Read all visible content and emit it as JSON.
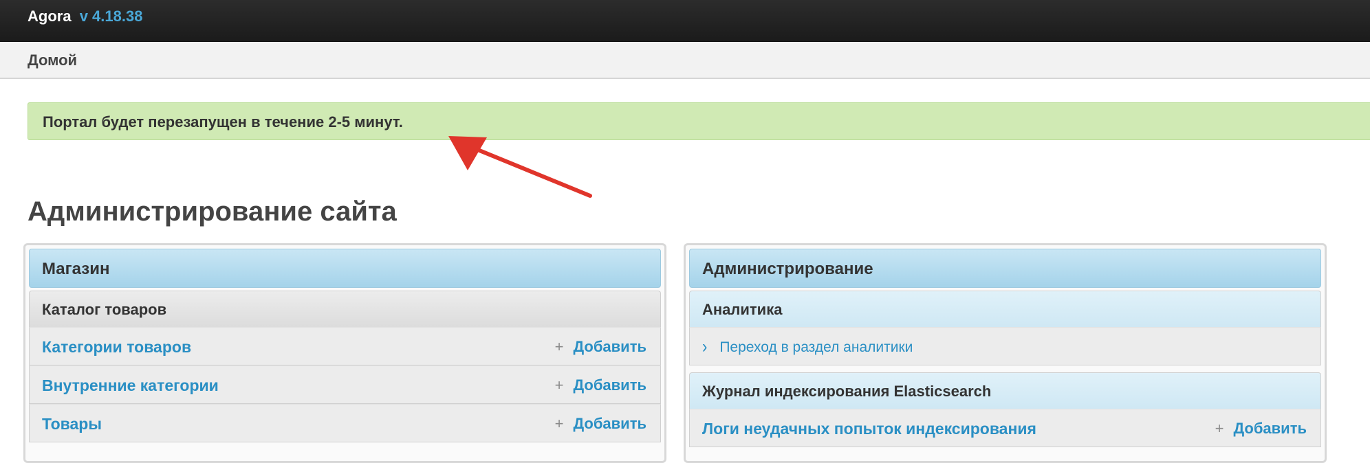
{
  "header": {
    "brand": "Agora",
    "version": "v 4.18.38"
  },
  "breadcrumbs": {
    "home": "Домой"
  },
  "message": "Портал будет перезапущен в течение 2-5 минут.",
  "page_title": "Администрирование сайта",
  "colors": {
    "accent": "#2a8fc4",
    "success_bg": "#d0eab4",
    "arrow": "#e0352b"
  },
  "modules": {
    "shop": {
      "caption": "Магазин",
      "group": "Каталог товаров",
      "rows": [
        {
          "label": "Категории товаров",
          "add": "Добавить"
        },
        {
          "label": "Внутренние категории",
          "add": "Добавить"
        },
        {
          "label": "Товары",
          "add": "Добавить"
        }
      ]
    },
    "admin": {
      "caption": "Администрирование",
      "analytics_group": "Аналитика",
      "analytics_link": "Переход в раздел аналитики",
      "es_group": "Журнал индексирования Elasticsearch",
      "es_row": {
        "label": "Логи неудачных попыток индексирования",
        "add": "Добавить"
      }
    }
  }
}
